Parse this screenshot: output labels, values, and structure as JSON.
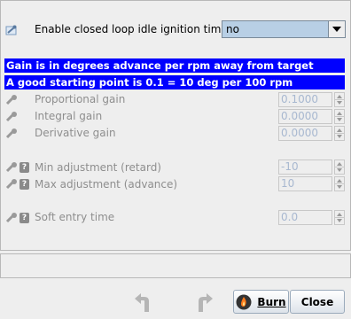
{
  "enable": {
    "label": "Enable closed loop idle ignition timing",
    "value": "no"
  },
  "banners": [
    "Gain is in degrees advance per rpm away from target",
    "A good starting point is 0.1 = 10 deg per 100 rpm"
  ],
  "fields": {
    "proportional": {
      "label": "Proportional gain",
      "value": "0.1000"
    },
    "integral": {
      "label": "Integral gain",
      "value": "0.0000"
    },
    "derivative": {
      "label": "Derivative gain",
      "value": "0.0000"
    },
    "min_adj": {
      "label": "Min adjustment (retard)",
      "value": "-10"
    },
    "max_adj": {
      "label": "Max adjustment (advance)",
      "value": "10"
    },
    "soft_entry": {
      "label": "Soft entry time",
      "value": "0.0"
    }
  },
  "buttons": {
    "burn": "Burn",
    "close": "Close"
  },
  "colors": {
    "banner": "#0000ff",
    "select_bg": "#b8cfe5",
    "disabled_text": "#8e8e8e"
  }
}
